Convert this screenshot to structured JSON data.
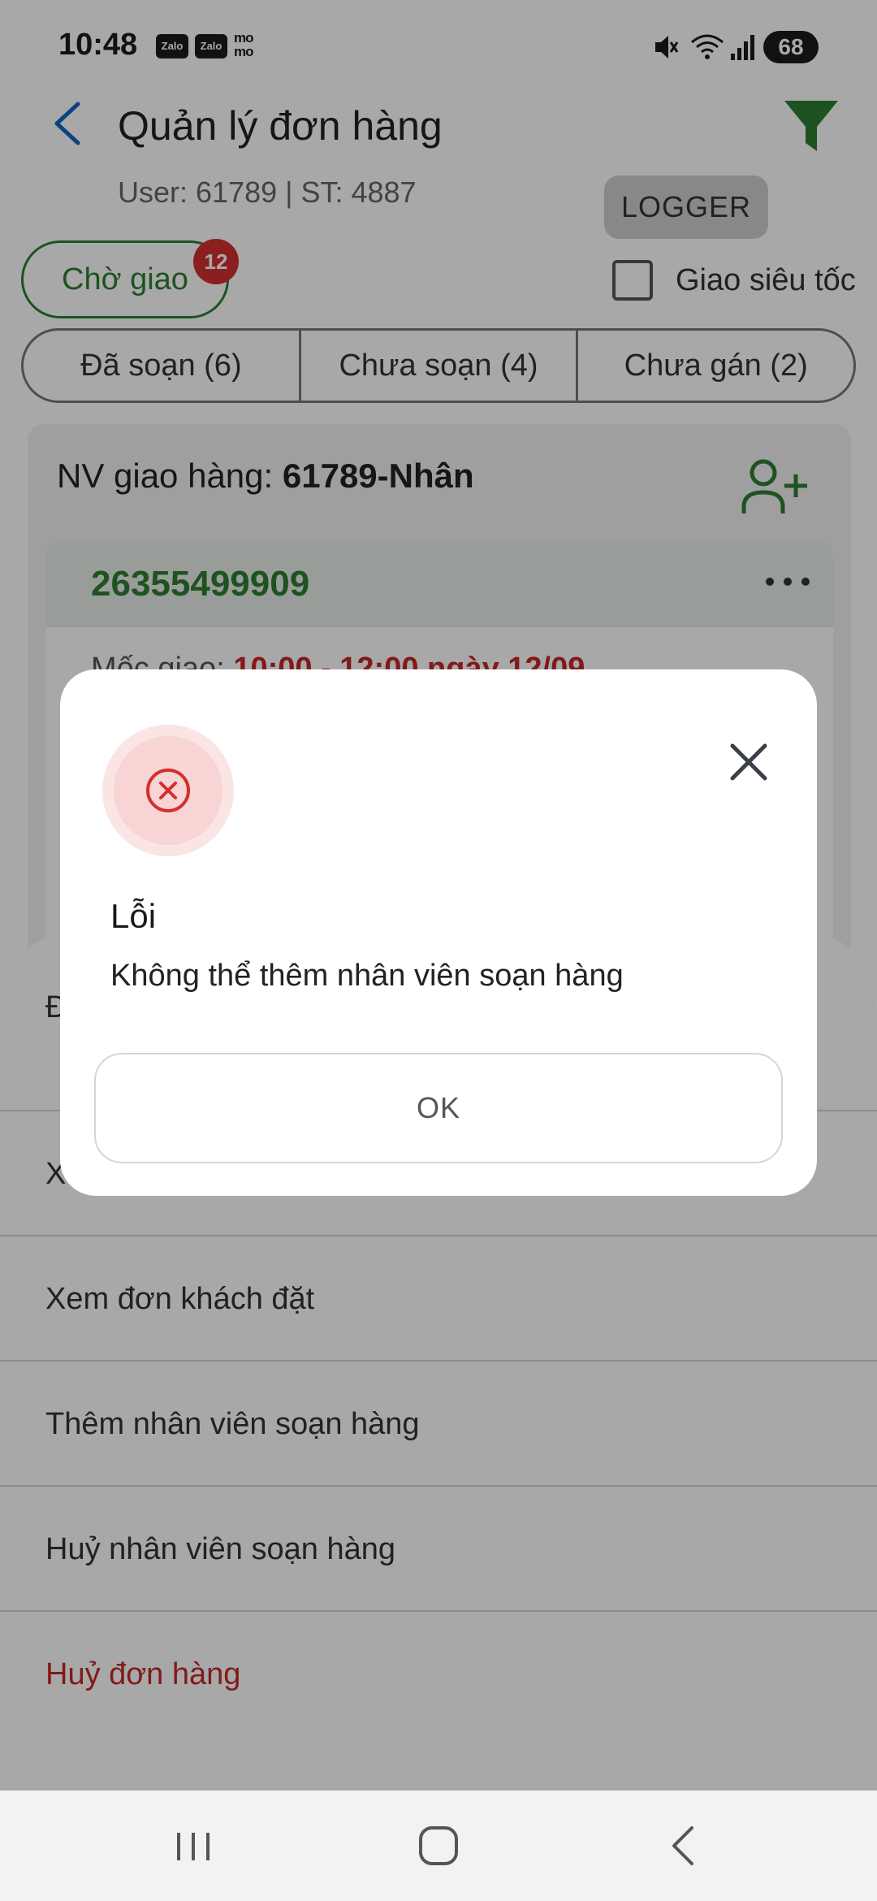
{
  "status_bar": {
    "time": "10:48",
    "notifications": [
      "Zalo",
      "Zalo",
      "mo mo"
    ],
    "battery": "68"
  },
  "header": {
    "title": "Quản lý đơn hàng",
    "user_line": "User: 61789 | ST: 4887",
    "logger_label": "LOGGER",
    "accent_color": "#2e7d32"
  },
  "filters": {
    "status_chip": "Chờ giao",
    "status_badge": "12",
    "express_label": "Giao siêu tốc",
    "express_checked": false
  },
  "segments": [
    "Đã soạn (6)",
    "Chưa soạn (4)",
    "Chưa gán (2)"
  ],
  "card": {
    "nv_label": "NV giao hàng: ",
    "nv_value": "61789-Nhân",
    "order_id": "26355499909",
    "slot_label": "Mốc giao: ",
    "slot_value": "10:00 - 12:00 ngày 12/09"
  },
  "sheet": {
    "items": [
      "Đ",
      "X",
      "Xem đơn khách đặt",
      "Thêm nhân viên soạn hàng",
      "Huỷ nhân viên soạn hàng",
      "Huỷ đơn hàng"
    ]
  },
  "dialog": {
    "title": "Lỗi",
    "message": "Không thể thêm nhân viên soạn hàng",
    "ok_label": "OK",
    "icon": "error-x-icon",
    "icon_color": "#d32f2f"
  },
  "navbar": {
    "icons": [
      "recent-apps-icon",
      "home-icon",
      "back-icon"
    ]
  }
}
